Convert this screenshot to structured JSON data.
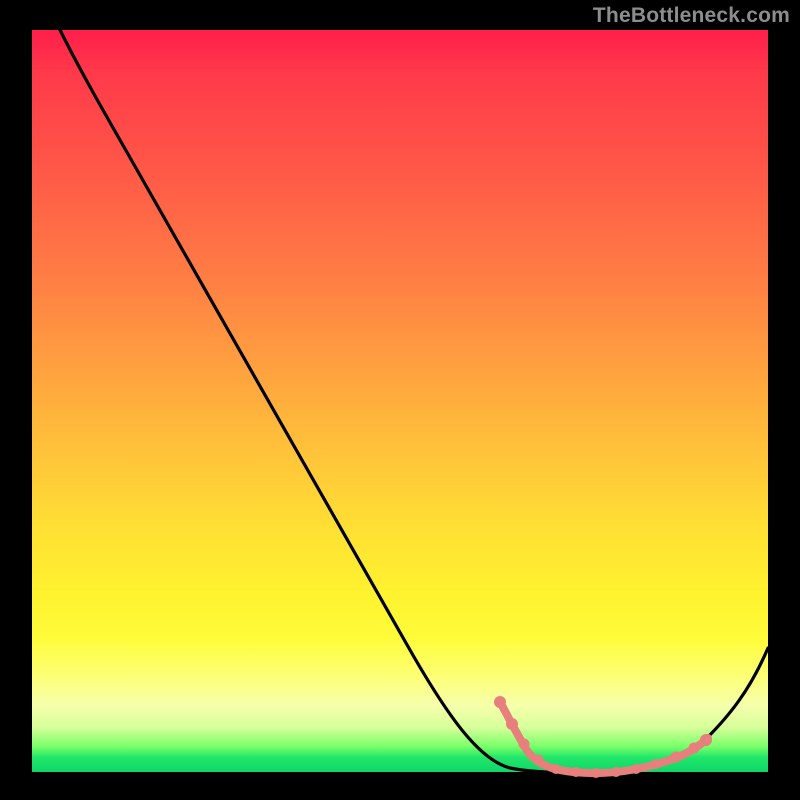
{
  "watermark": "TheBottleneck.com",
  "chart_data": {
    "type": "line",
    "title": "",
    "xlabel": "",
    "ylabel": "",
    "xlim": [
      0,
      100
    ],
    "ylim": [
      0,
      100
    ],
    "grid": false,
    "legend": false,
    "series": [
      {
        "name": "bottleneck-curve",
        "color": "#000000",
        "x": [
          4,
          10,
          20,
          30,
          40,
          50,
          60,
          66,
          70,
          74,
          78,
          82,
          86,
          90,
          100
        ],
        "y": [
          100,
          91,
          76.5,
          62,
          47.5,
          33,
          18.5,
          9,
          4,
          1.5,
          0.8,
          0.8,
          1.5,
          3.5,
          17
        ]
      }
    ],
    "highlighted_points": {
      "name": "salmon-dots",
      "color": "#e77f7d",
      "x": [
        66,
        69,
        71,
        73,
        75,
        77,
        79,
        81,
        83,
        85,
        87,
        89,
        90
      ],
      "y": [
        9,
        5.5,
        3.5,
        2,
        1.2,
        0.9,
        0.8,
        0.8,
        1.0,
        1.4,
        2.0,
        3.0,
        3.6
      ]
    },
    "gradient_stops": [
      {
        "pos": 0,
        "color": "#ff1f4b"
      },
      {
        "pos": 50,
        "color": "#ffb63c"
      },
      {
        "pos": 80,
        "color": "#fff530"
      },
      {
        "pos": 95,
        "color": "#c8ff8a"
      },
      {
        "pos": 100,
        "color": "#0fd66a"
      }
    ]
  }
}
